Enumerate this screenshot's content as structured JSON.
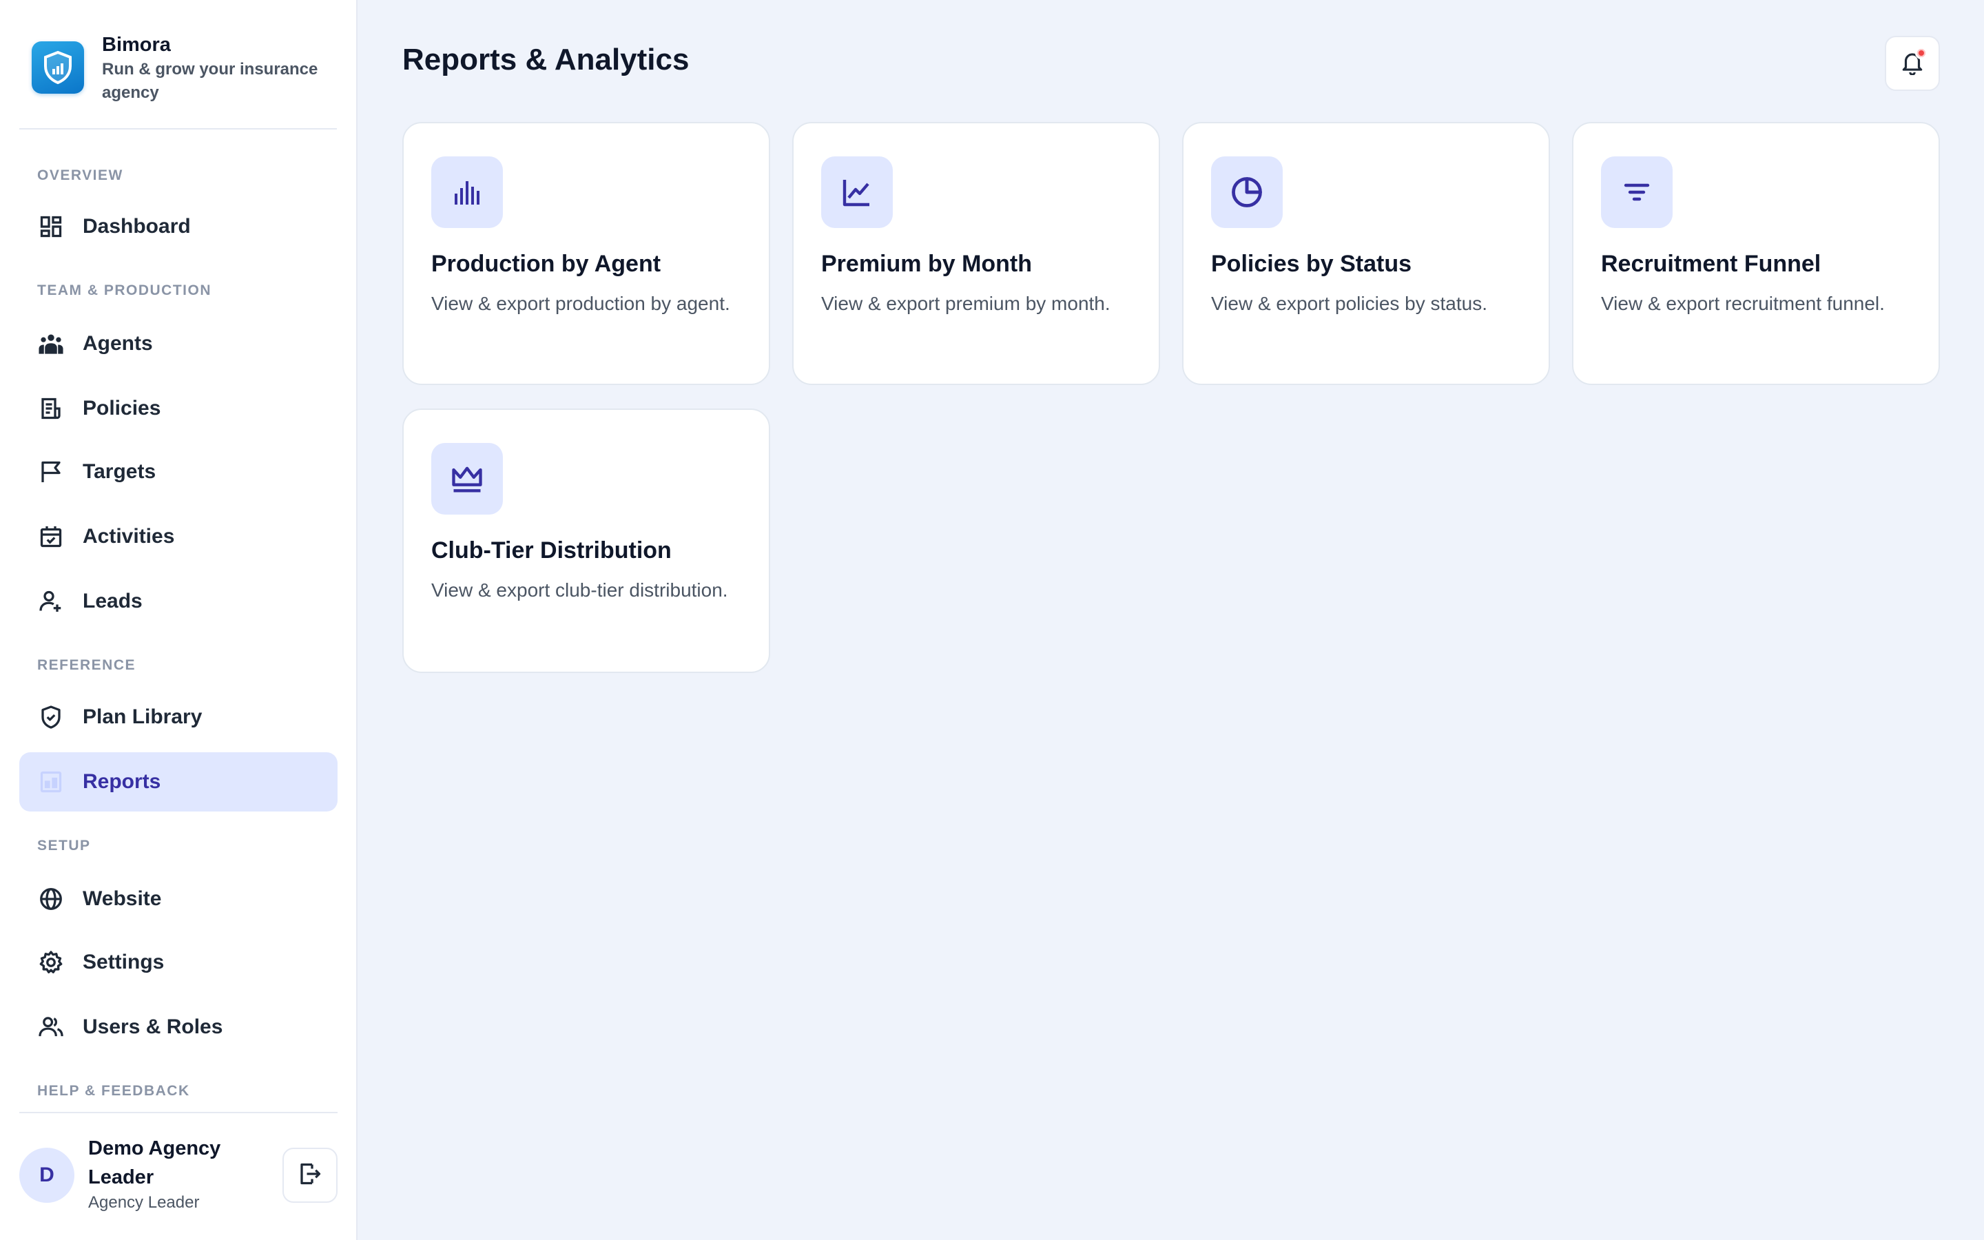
{
  "brand": {
    "name": "Bimora",
    "tagline": "Run & grow your insurance agency"
  },
  "sidebar": {
    "sections": [
      {
        "label": "OVERVIEW"
      },
      {
        "label": "TEAM & PRODUCTION"
      },
      {
        "label": "REFERENCE"
      },
      {
        "label": "SETUP"
      },
      {
        "label": "HELP & FEEDBACK"
      }
    ],
    "items": [
      {
        "label": "Dashboard",
        "icon": "dashboard-icon"
      },
      {
        "label": "Agents",
        "icon": "agents-icon"
      },
      {
        "label": "Policies",
        "icon": "policies-icon"
      },
      {
        "label": "Targets",
        "icon": "flag-icon"
      },
      {
        "label": "Activities",
        "icon": "calendar-check-icon"
      },
      {
        "label": "Leads",
        "icon": "user-plus-icon"
      },
      {
        "label": "Plan Library",
        "icon": "shield-check-icon"
      },
      {
        "label": "Reports",
        "icon": "reports-icon",
        "active": true
      },
      {
        "label": "Website",
        "icon": "globe-icon"
      },
      {
        "label": "Settings",
        "icon": "gear-icon"
      },
      {
        "label": "Users & Roles",
        "icon": "users-icon"
      }
    ]
  },
  "user": {
    "initial": "D",
    "name": "Demo Agency Leader",
    "role": "Agency Leader"
  },
  "page": {
    "title": "Reports & Analytics"
  },
  "cards": [
    {
      "title": "Production by Agent",
      "description": "View & export production by agent.",
      "icon": "bar-chart-icon"
    },
    {
      "title": "Premium by Month",
      "description": "View & export premium by month.",
      "icon": "line-chart-icon"
    },
    {
      "title": "Policies by Status",
      "description": "View & export policies by status.",
      "icon": "pie-chart-icon"
    },
    {
      "title": "Recruitment Funnel",
      "description": "View & export recruitment funnel.",
      "icon": "funnel-icon"
    },
    {
      "title": "Club-Tier Distribution",
      "description": "View & export club-tier distribution.",
      "icon": "crown-icon"
    }
  ],
  "colors": {
    "accent": "#3730a3",
    "accent_soft": "#e0e7ff",
    "background": "#eff3fb",
    "notification": "#ef4444"
  }
}
